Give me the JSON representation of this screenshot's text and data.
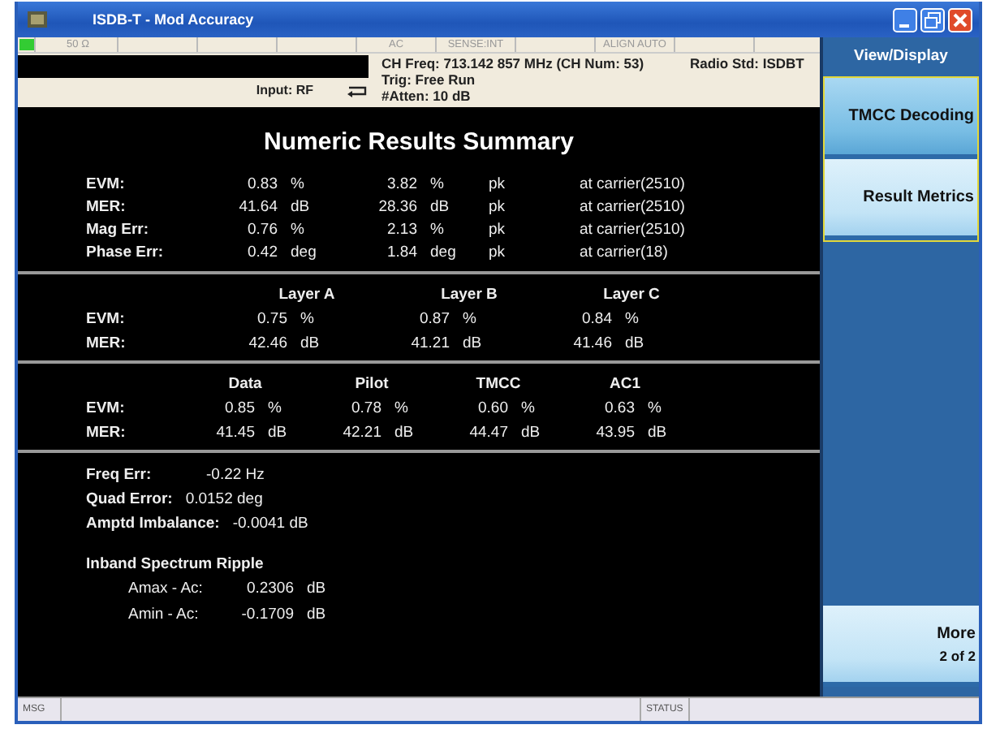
{
  "window": {
    "title": "ISDB-T - Mod Accuracy"
  },
  "status_segments": [
    "50 Ω",
    "AC",
    "SENSE:INT",
    "ALIGN AUTO"
  ],
  "info": {
    "input": "Input: RF",
    "ch_freq": "CH Freq: 713.142 857 MHz (CH Num: 53)",
    "trig": "Trig: Free Run",
    "atten": "#Atten: 10 dB",
    "radio_std": "Radio Std: ISDBT"
  },
  "results": {
    "title": "Numeric Results Summary",
    "summary": [
      {
        "label": "EVM:",
        "value": "0.83",
        "unit": "%",
        "peak_value": "3.82",
        "peak_unit": "%",
        "peak": "pk",
        "location": "at carrier(2510)"
      },
      {
        "label": "MER:",
        "value": "41.64",
        "unit": "dB",
        "peak_value": "28.36",
        "peak_unit": "dB",
        "peak": "pk",
        "location": "at carrier(2510)"
      },
      {
        "label": "Mag Err:",
        "value": "0.76",
        "unit": "%",
        "peak_value": "2.13",
        "peak_unit": "%",
        "peak": "pk",
        "location": "at carrier(2510)"
      },
      {
        "label": "Phase Err:",
        "value": "0.42",
        "unit": "deg",
        "peak_value": "1.84",
        "peak_unit": "deg",
        "peak": "pk",
        "location": "at carrier(18)"
      }
    ],
    "layers": {
      "columns": [
        "Layer A",
        "Layer B",
        "Layer C"
      ],
      "rows": [
        {
          "label": "EVM:",
          "cells": [
            {
              "value": "0.75",
              "unit": "%"
            },
            {
              "value": "0.87",
              "unit": "%"
            },
            {
              "value": "0.84",
              "unit": "%"
            }
          ]
        },
        {
          "label": "MER:",
          "cells": [
            {
              "value": "42.46",
              "unit": "dB"
            },
            {
              "value": "41.21",
              "unit": "dB"
            },
            {
              "value": "41.46",
              "unit": "dB"
            }
          ]
        }
      ]
    },
    "carriers": {
      "columns": [
        "Data",
        "Pilot",
        "TMCC",
        "AC1"
      ],
      "rows": [
        {
          "label": "EVM:",
          "cells": [
            {
              "value": "0.85",
              "unit": "%"
            },
            {
              "value": "0.78",
              "unit": "%"
            },
            {
              "value": "0.60",
              "unit": "%"
            },
            {
              "value": "0.63",
              "unit": "%"
            }
          ]
        },
        {
          "label": "MER:",
          "cells": [
            {
              "value": "41.45",
              "unit": "dB"
            },
            {
              "value": "42.21",
              "unit": "dB"
            },
            {
              "value": "44.47",
              "unit": "dB"
            },
            {
              "value": "43.95",
              "unit": "dB"
            }
          ]
        }
      ]
    },
    "errors": [
      {
        "label": "Freq Err:",
        "value": "-0.22 Hz"
      },
      {
        "label": "Quad Error:",
        "value": "0.0152 deg"
      },
      {
        "label": "Amptd Imbalance:",
        "value": "-0.0041 dB"
      }
    ],
    "ripple": {
      "title": "Inband Spectrum Ripple",
      "rows": [
        {
          "label": "Amax - Ac:",
          "value": "0.2306",
          "unit": "dB"
        },
        {
          "label": "Amin - Ac:",
          "value": "-0.1709",
          "unit": "dB"
        }
      ]
    }
  },
  "menu": {
    "title": "View/Display",
    "softkeys": [
      {
        "label": "TMCC Decoding",
        "selected": true,
        "kind": "grouped"
      },
      {
        "label": "Result Metrics",
        "selected": false,
        "kind": "grouped"
      },
      {
        "label": "More",
        "sublabel": "2 of 2",
        "selected": false,
        "kind": "more"
      }
    ]
  },
  "status_bar": {
    "msg": "MSG",
    "status": "STATUS"
  }
}
